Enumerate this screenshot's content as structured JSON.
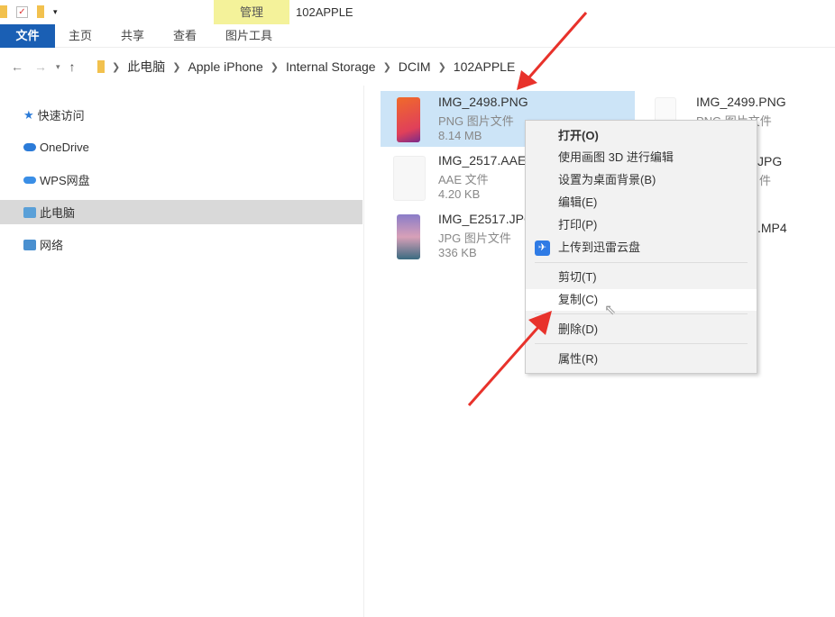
{
  "window": {
    "title": "102APPLE",
    "context_tab": "管理"
  },
  "ribbon": {
    "tabs": [
      "文件",
      "主页",
      "共享",
      "查看",
      "图片工具"
    ]
  },
  "address": {
    "crumbs": [
      "此电脑",
      "Apple iPhone",
      "Internal Storage",
      "DCIM",
      "102APPLE"
    ]
  },
  "sidebar": {
    "items": [
      {
        "label": "快速访问"
      },
      {
        "label": "OneDrive"
      },
      {
        "label": "WPS网盘"
      },
      {
        "label": "此电脑",
        "selected": true
      },
      {
        "label": "网络"
      }
    ]
  },
  "files": [
    {
      "name": "IMG_2498.PNG",
      "type": "PNG 图片文件",
      "size": "8.14 MB",
      "selected": true
    },
    {
      "name": "IMG_2517.AAE",
      "type": "AAE 文件",
      "size": "4.20 KB"
    },
    {
      "name": "IMG_E2517.JPG",
      "type": "JPG 图片文件",
      "size": "336 KB"
    },
    {
      "name": "IMG_2499.PNG",
      "type": "PNG 图片文件"
    }
  ],
  "partial_files": [
    {
      "fragment": "JPG",
      "type_fragment": "件"
    },
    {
      "fragment": ".MP4"
    }
  ],
  "context_menu": {
    "items": [
      "打开(O)",
      "使用画图 3D 进行编辑",
      "设置为桌面背景(B)",
      "编辑(E)",
      "打印(P)",
      "上传到迅雷云盘",
      "剪切(T)",
      "复制(C)",
      "删除(D)",
      "属性(R)"
    ],
    "highlighted": "复制(C)"
  },
  "colors": {
    "accent": "#1a5fb4",
    "selection": "#cce4f7",
    "manage_tab": "#f4f29a",
    "arrow": "#e8322b"
  }
}
